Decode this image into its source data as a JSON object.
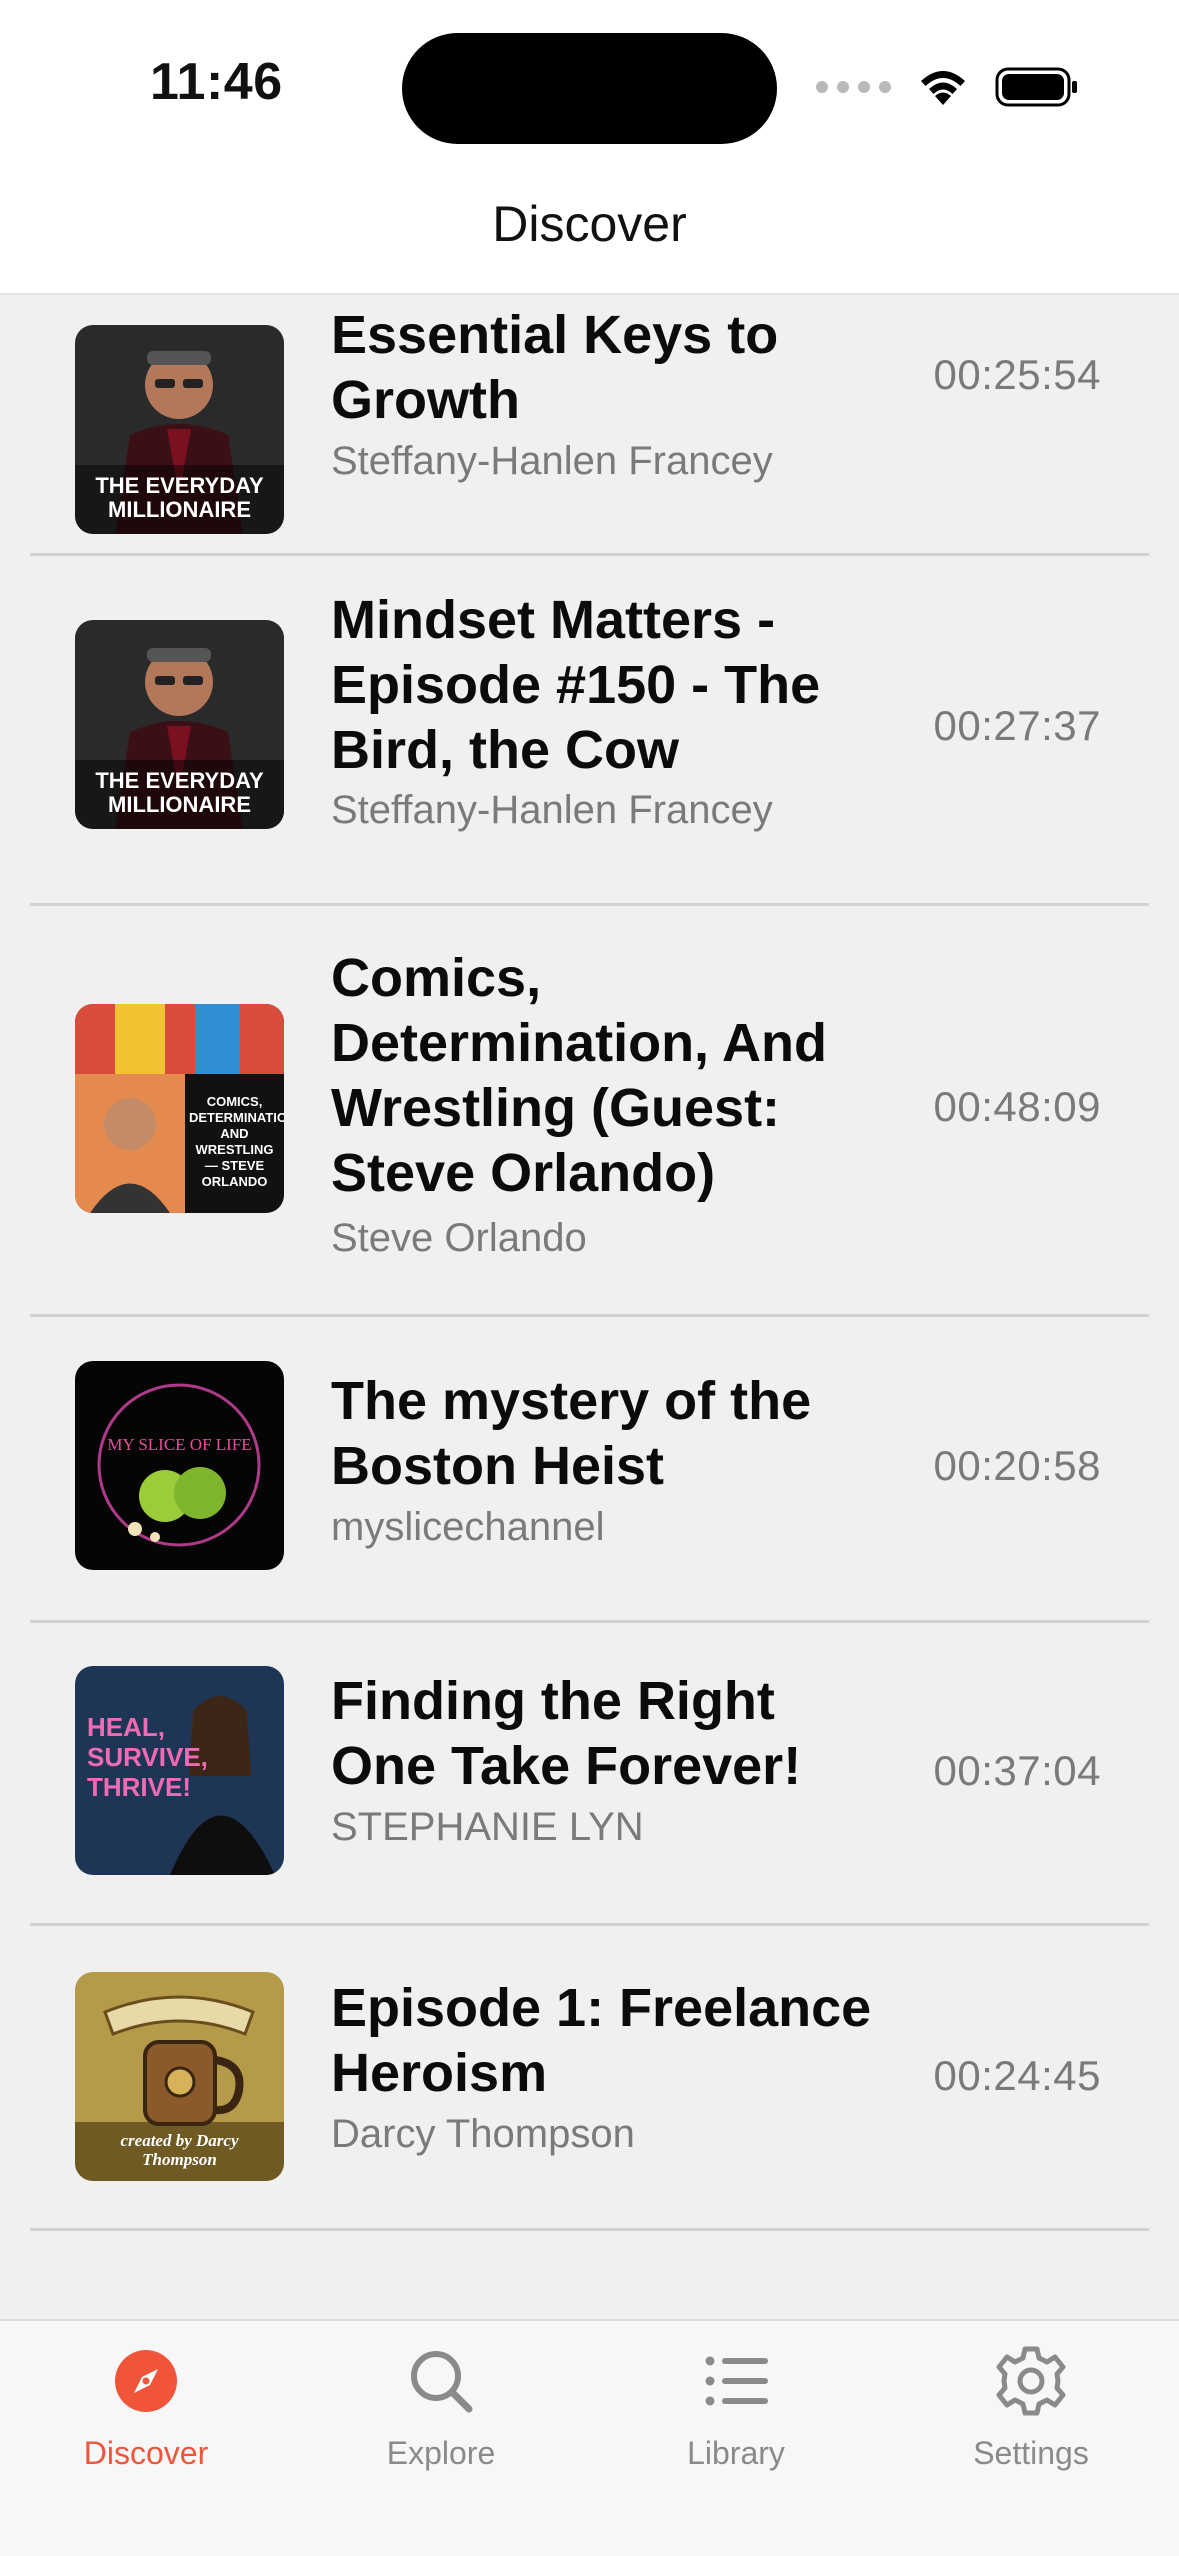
{
  "status_bar": {
    "time": "11:46"
  },
  "nav": {
    "title": "Discover"
  },
  "episodes": [
    {
      "title": "Essential Keys to Growth",
      "author": "Steffany-Hanlen Francey",
      "duration": "00:25:54",
      "artwork": "the-everyday-millionaire-artwork",
      "artwork_text": "THE EVERYDAY MILLIONAIRE"
    },
    {
      "title": "Mindset Matters - Episode #150 - The Bird, the Cow",
      "author": "Steffany-Hanlen Francey",
      "duration": "00:27:37",
      "artwork": "the-everyday-millionaire-artwork",
      "artwork_text": "THE EVERYDAY MILLIONAIRE"
    },
    {
      "title": "Comics, Determination, And Wrestling (Guest: Steve Orlando)",
      "author": "Steve Orlando",
      "duration": "00:48:09",
      "artwork": "comics-episode-artwork",
      "artwork_text": "COMICS, DETERMINATION AND WRESTLING — STEVE ORLANDO"
    },
    {
      "title": "The mystery of the Boston Heist",
      "author": "myslicechannel",
      "duration": "00:20:58",
      "artwork": "my-slice-of-life-artwork",
      "artwork_text": "MY SLICE OF LIFE"
    },
    {
      "title": "Finding the Right One Take Forever!",
      "author": "STEPHANIE LYN",
      "duration": "00:37:04",
      "artwork": "heal-survive-thrive-artwork",
      "artwork_text": "HEAL, SURVIVE, THRIVE!"
    },
    {
      "title": "Episode 1: Freelance Heroism",
      "author": "Darcy Thompson",
      "duration": "00:24:45",
      "artwork": "dragons-rest-artwork",
      "artwork_text": "created by Darcy Thompson"
    }
  ],
  "tabs": [
    {
      "label": "Discover",
      "icon": "compass-icon",
      "active": true
    },
    {
      "label": "Explore",
      "icon": "search-icon",
      "active": false
    },
    {
      "label": "Library",
      "icon": "list-icon",
      "active": false
    },
    {
      "label": "Settings",
      "icon": "gear-icon",
      "active": false
    }
  ],
  "colors": {
    "accent": "#f0553a",
    "background": "#f0f0f0",
    "secondary_text": "#7a7a7a"
  }
}
